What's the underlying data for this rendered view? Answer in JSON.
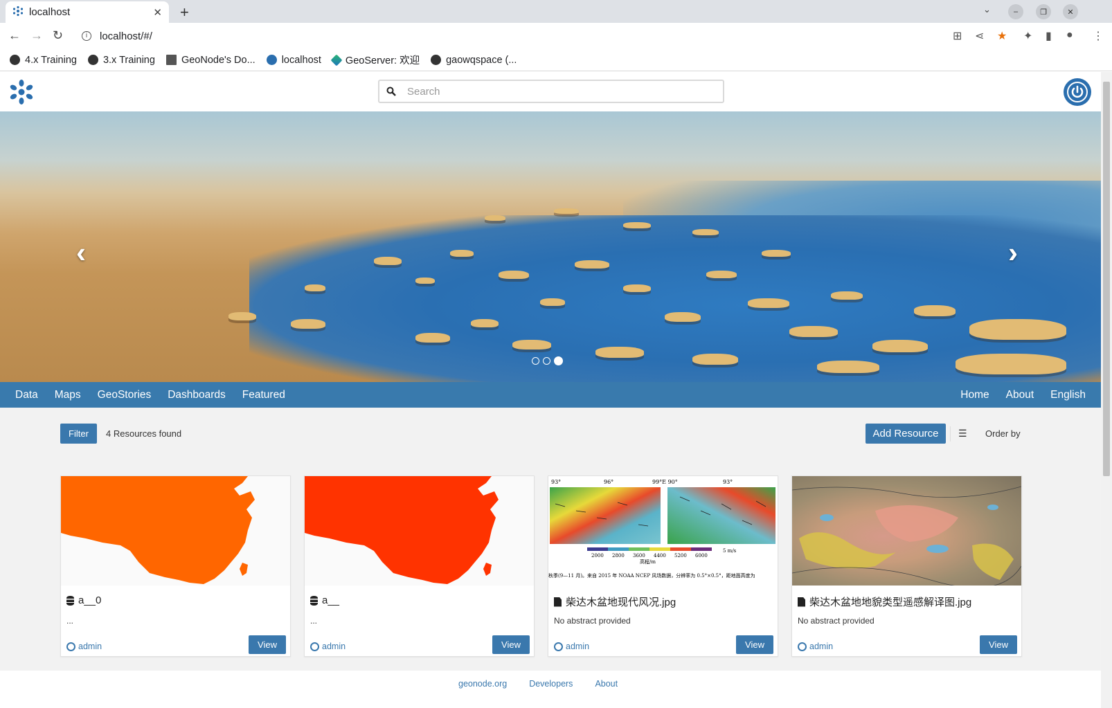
{
  "browser": {
    "tab_title": "localhost",
    "url": "localhost/#/",
    "bookmarks": [
      {
        "label": "4.x Training"
      },
      {
        "label": "3.x Training"
      },
      {
        "label": "GeoNode's Do..."
      },
      {
        "label": "localhost"
      },
      {
        "label": "GeoServer: 欢迎"
      },
      {
        "label": "gaowqspace (..."
      }
    ]
  },
  "header": {
    "search_placeholder": "Search"
  },
  "hero": {
    "slides": 3,
    "active_slide": 3
  },
  "nav": {
    "left": [
      "Data",
      "Maps",
      "GeoStories",
      "Dashboards",
      "Featured"
    ],
    "right": [
      "Home",
      "About",
      "English"
    ]
  },
  "toolbar": {
    "filter_label": "Filter",
    "found_text": "4 Resources found",
    "add_resource_label": "Add Resource",
    "order_by_label": "Order by"
  },
  "cards": [
    {
      "title": "a__0",
      "type": "dataset",
      "abstract": "...",
      "owner": "admin",
      "view_label": "View",
      "thumb_color": "#ff6600"
    },
    {
      "title": "a__",
      "type": "dataset",
      "abstract": "...",
      "owner": "admin",
      "view_label": "View",
      "thumb_color": "#ff3300"
    },
    {
      "title": "柴达木盆地现代风况.jpg",
      "type": "document",
      "abstract": "No abstract provided",
      "owner": "admin",
      "view_label": "View",
      "thumb_text_top": [
        "93°",
        "96°",
        "99°E 90°",
        "93°"
      ],
      "thumb_legend": [
        "2000",
        "2800",
        "3600",
        "4400",
        "5200",
        "6000"
      ],
      "thumb_unit": "高程/m",
      "thumb_scale": "5 m/s",
      "thumb_caption": "秋季(9—11 月)。来自 2015 年 NOAA NCEP 风场数据，分辨率为 0.5°×0.5°，距地面高度为"
    },
    {
      "title": "柴达木盆地地貌类型遥感解译图.jpg",
      "type": "document",
      "abstract": "No abstract provided",
      "owner": "admin",
      "view_label": "View"
    }
  ],
  "footer": {
    "links": [
      "geonode.org",
      "Developers",
      "About"
    ]
  },
  "colors": {
    "accent": "#397aad",
    "brand_icon": "#2a6eae"
  }
}
